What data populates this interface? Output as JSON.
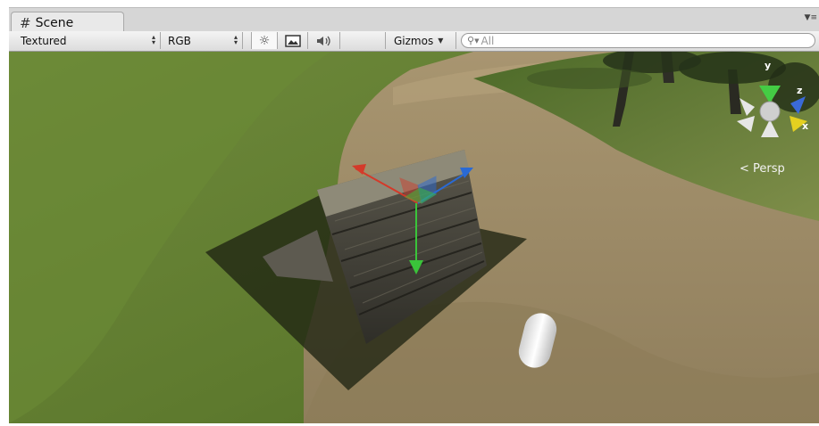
{
  "scene_tab": {
    "label": "Scene",
    "icon": "grid-hash-icon"
  },
  "toolbar": {
    "render_mode": "Textured",
    "color_mode": "RGB",
    "lighting_icon": "sun-icon",
    "image_icon": "image-icon",
    "audio_icon": "speaker-icon",
    "gizmos_label": "Gizmos",
    "search_value": "All"
  },
  "gizmo": {
    "x_label": "x",
    "y_label": "y",
    "z_label": "z",
    "projection_label": "Persp"
  }
}
